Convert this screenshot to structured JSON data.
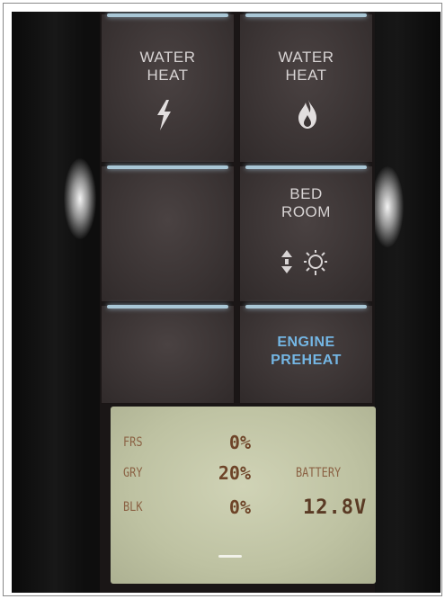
{
  "buttons": [
    {
      "label": "WATER\nHEAT",
      "icon": "lightning-bolt-icon"
    },
    {
      "label": "WATER\nHEAT",
      "icon": "flame-icon"
    },
    {
      "label": "",
      "icon": ""
    },
    {
      "label": "BED\nROOM",
      "icon": "thermostat-sun-icon"
    },
    {
      "label": "",
      "icon": ""
    },
    {
      "label": "ENGINE\nPREHEAT",
      "icon": "",
      "accent": "#74b6e4"
    }
  ],
  "display": {
    "tanks": [
      {
        "label": "FRS",
        "value": "0%"
      },
      {
        "label": "GRY",
        "value": "20%"
      },
      {
        "label": "BLK",
        "value": "0%"
      }
    ],
    "battery_label": "BATTERY",
    "battery_value": "12.8V"
  },
  "colors": {
    "lcd_background": "#c4c8a8",
    "lcd_text": "#6e4428",
    "button_glow": "#a9c7d6",
    "engine_preheat_text": "#74b6e4"
  }
}
